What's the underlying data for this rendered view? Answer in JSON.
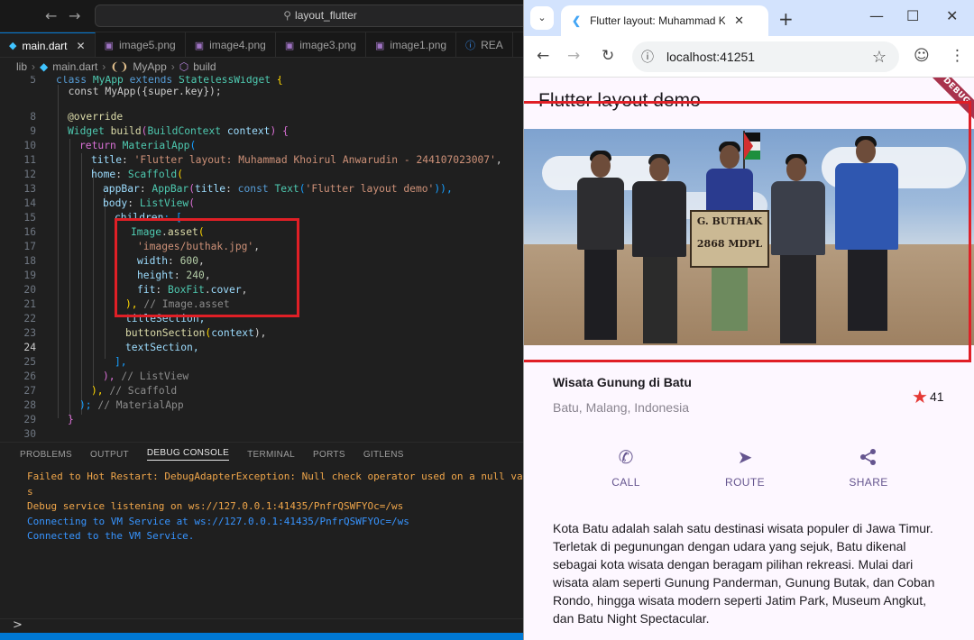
{
  "vscode": {
    "search_text": "layout_flutter",
    "tabs": [
      {
        "label": "main.dart",
        "icon": "dart-icon"
      },
      {
        "label": "image5.png",
        "icon": "image-icon"
      },
      {
        "label": "image4.png",
        "icon": "image-icon"
      },
      {
        "label": "image3.png",
        "icon": "image-icon"
      },
      {
        "label": "image1.png",
        "icon": "image-icon"
      },
      {
        "label": "REA",
        "icon": "info-icon"
      }
    ],
    "breadcrumb": [
      "lib",
      "main.dart",
      "MyApp",
      "build"
    ],
    "line_numbers": [
      "5",
      "7",
      "8",
      "9",
      "10",
      "11",
      "12",
      "13",
      "14",
      "15",
      "16",
      "17",
      "18",
      "19",
      "20",
      "21",
      "22",
      "23",
      "24",
      "25",
      "26",
      "27",
      "28",
      "29",
      "30"
    ],
    "code": {
      "l5a": "class ",
      "l5b": "MyApp ",
      "l5c": "extends ",
      "l5d": "StatelessWidget ",
      "l5e": "{",
      "l7": "  const MyApp({super.key});",
      "l8": "@override",
      "l9a": "Widget ",
      "l9b": "build",
      "l9c": "(",
      "l9d": "BuildContext ",
      "l9e": "context",
      "l9f": ") {",
      "l10a": "return ",
      "l10b": "MaterialApp",
      "l10c": "(",
      "l11a": "title",
      "l11b": ": ",
      "l11c": "'Flutter layout: Muhammad Khoirul Anwarudin - 244107023007'",
      "l11d": ",",
      "l12a": "home",
      "l12b": ": ",
      "l12c": "Scaffold",
      "l12d": "(",
      "l13a": "appBar",
      "l13b": ": ",
      "l13c": "AppBar",
      "l13d": "(",
      "l13e": "title",
      "l13f": ": ",
      "l13g": "const ",
      "l13h": "Text",
      "l13i": "(",
      "l13j": "'Flutter layout demo'",
      "l13k": ")),",
      "l14a": "body",
      "l14b": ": ",
      "l14c": "ListView",
      "l14d": "(",
      "l15a": "children",
      "l15b": ": [",
      "l16a": "Image",
      "l16b": ".",
      "l16c": "asset",
      "l16d": "(",
      "l17": "'images/buthak.jpg'",
      "l17b": ",",
      "l18a": "width",
      "l18b": ": ",
      "l18c": "600",
      "l18d": ",",
      "l19a": "height",
      "l19b": ": ",
      "l19c": "240",
      "l19d": ",",
      "l20a": "fit",
      "l20b": ": ",
      "l20c": "BoxFit",
      "l20d": ".",
      "l20e": "cover",
      "l20f": ",",
      "l21a": "), ",
      "l21b": "// Image.asset",
      "l22": "titleSection,",
      "l23a": "buttonSection",
      "l23b": "(",
      "l23c": "context",
      "l23d": "),",
      "l24": "textSection,",
      "l25": "],",
      "l26a": "), ",
      "l26b": "// ListView",
      "l27a": "), ",
      "l27b": "// Scaffold",
      "l28a": "); ",
      "l28b": "// MaterialApp",
      "l29": "}"
    },
    "panel_tabs": [
      "PROBLEMS",
      "OUTPUT",
      "DEBUG CONSOLE",
      "TERMINAL",
      "PORTS",
      "GITLENS"
    ],
    "console": [
      {
        "text": "Failed to Hot Restart: DebugAdapterException: Null check operator used on a null value",
        "type": "err"
      },
      {
        "text": "s",
        "type": "err"
      },
      {
        "text": "Debug service listening on ws://127.0.0.1:41435/PnfrQSWFYOc=/ws",
        "type": "err"
      },
      {
        "text": "Connecting to VM Service at ws://127.0.0.1:41435/PnfrQSWFYOc=/ws",
        "type": "info"
      },
      {
        "text": "Connected to the VM Service.",
        "type": "info"
      }
    ],
    "prompt": ">"
  },
  "browser": {
    "tab_title": "Flutter layout: Muhammad Khoi",
    "url": "localhost:41251"
  },
  "app": {
    "appbar_title": "Flutter layout demo",
    "debug_banner": "DEBUG",
    "sign_line1": "G. BUTHAK",
    "sign_line2": "2868 MDPL",
    "location_title": "Wisata Gunung di Batu",
    "location_subtitle": "Batu, Malang, Indonesia",
    "favorite_count": "41",
    "actions": [
      {
        "label": "CALL",
        "icon": "phone-icon"
      },
      {
        "label": "ROUTE",
        "icon": "navigation-icon"
      },
      {
        "label": "SHARE",
        "icon": "share-icon"
      }
    ],
    "description": "Kota Batu adalah salah satu destinasi wisata populer di Jawa Timur. Terletak di pegunungan dengan udara yang sejuk, Batu dikenal sebagai kota wisata dengan beragam pilihan rekreasi. Mulai dari wisata alam seperti Gunung Panderman, Gunung Butak, dan Coban Rondo, hingga wisata modern seperti Jatim Park, Museum Angkut, dan Batu Night Spectacular."
  },
  "colors": {
    "accent_primary": "#65558f",
    "highlight_box": "#e01f26",
    "star": "#e53935",
    "vscode_accent": "#0078d4"
  }
}
